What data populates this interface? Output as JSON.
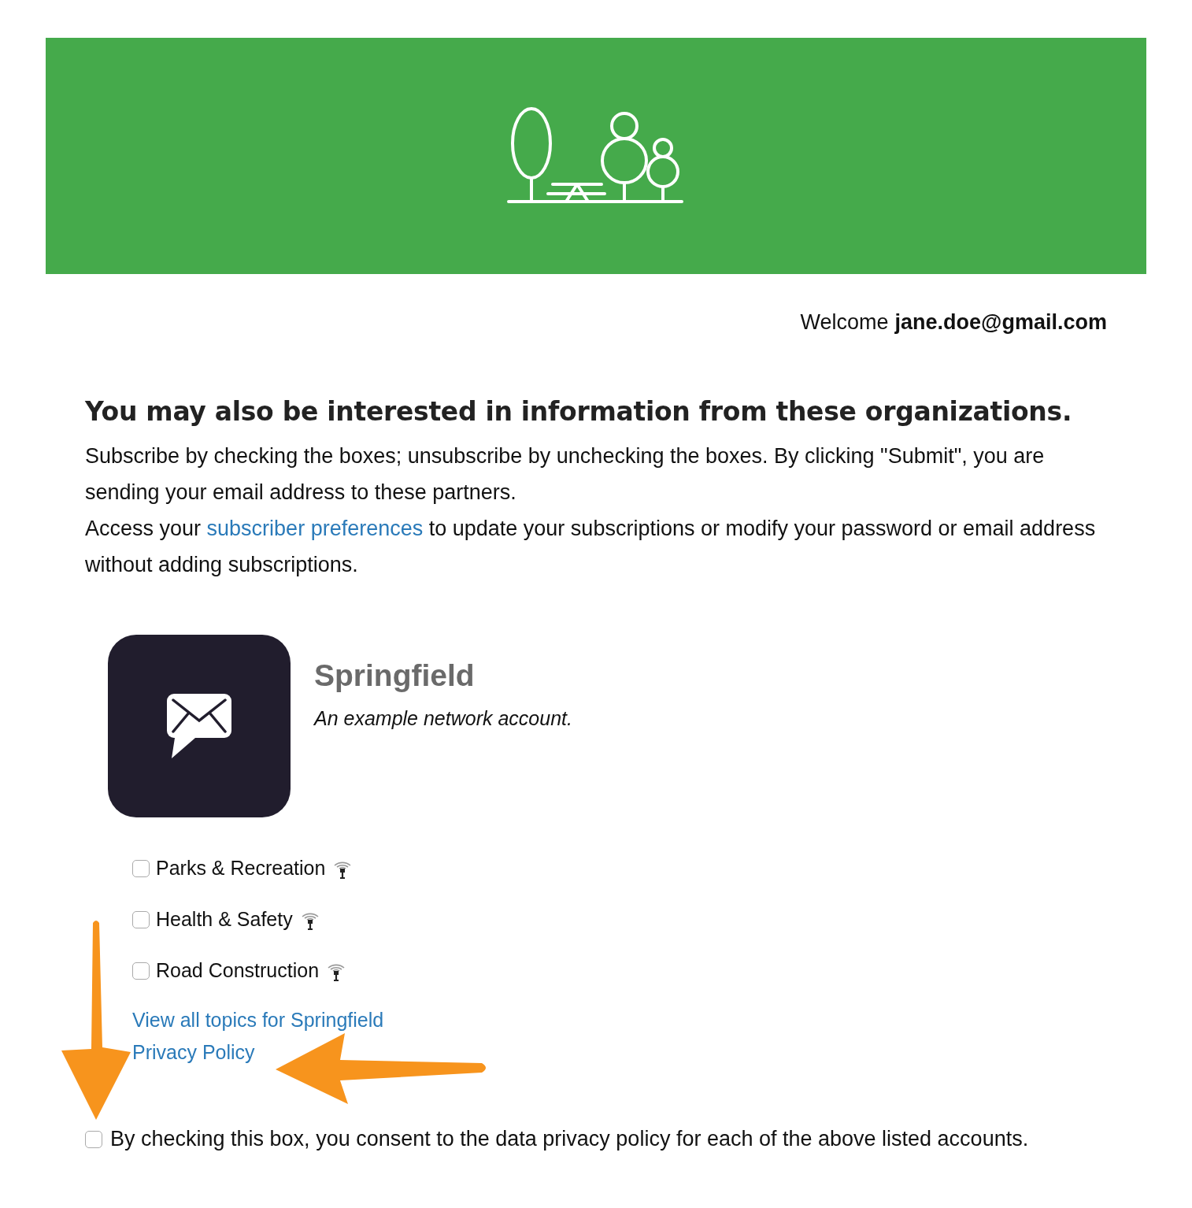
{
  "welcome": {
    "label": "Welcome",
    "email": "jane.doe@gmail.com"
  },
  "heading": "You may also be interested in information from these organizations.",
  "intro": "Subscribe by checking the boxes; unsubscribe by unchecking the boxes. By clicking \"Submit\", you are sending your email address to these partners.",
  "access": {
    "before": "Access your",
    "link": "subscriber preferences",
    "after": "to update your subscriptions or modify your password or email address without adding subscriptions."
  },
  "account": {
    "name": "Springfield",
    "description": "An example network account."
  },
  "topics": [
    {
      "label": "Parks & Recreation",
      "checked": false
    },
    {
      "label": "Health & Safety",
      "checked": false
    },
    {
      "label": "Road Construction",
      "checked": false
    }
  ],
  "links": [
    "View all topics for Springfield",
    "Privacy Policy"
  ],
  "consent": {
    "label": "By checking this box, you consent to the data privacy policy for each of the above listed accounts.",
    "checked": false
  }
}
